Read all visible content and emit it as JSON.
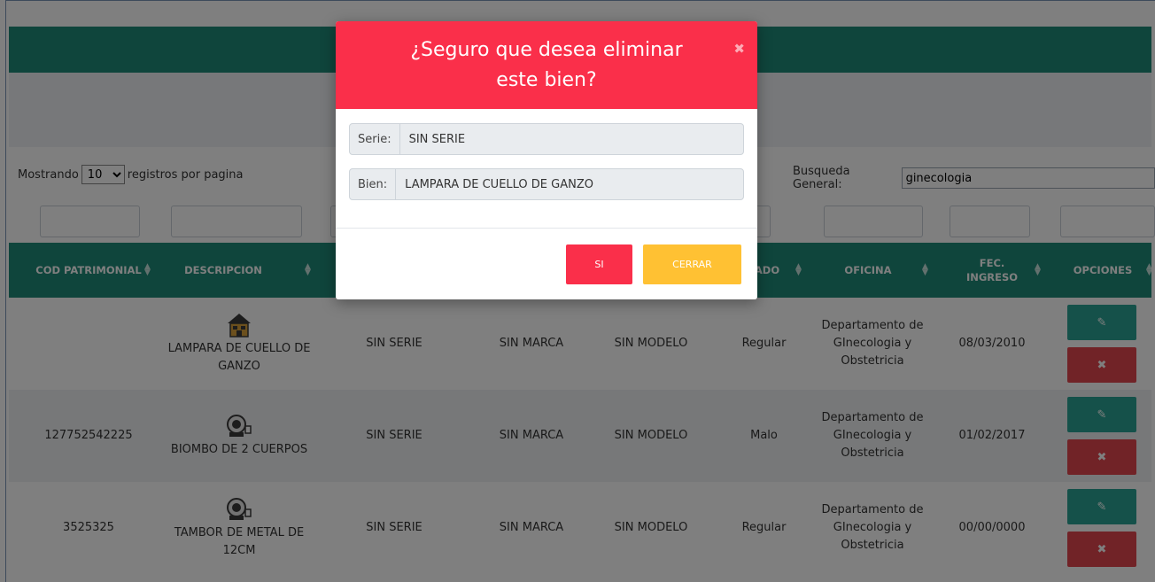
{
  "page": {
    "length_prefix": "Mostrando",
    "length_value": "10",
    "length_suffix": "registros por pagina",
    "search_label": "Busqueda General:",
    "search_value": "ginecologia"
  },
  "table": {
    "headers": [
      {
        "label": "COD PATRIMONIAL"
      },
      {
        "label": "DESCRIPCION"
      },
      {
        "label": "ADO"
      },
      {
        "label": "OFICINA"
      },
      {
        "label": "FEC. INGRESO"
      },
      {
        "label": "OPCIONES"
      }
    ],
    "rows": [
      {
        "cod": "",
        "icon": "house-icon",
        "descripcion": "LAMPARA DE CUELLO DE GANZO",
        "serie": "SIN SERIE",
        "marca": "SIN MARCA",
        "modelo": "SIN MODELO",
        "estado": "Regular",
        "oficina": "Departamento de GInecologia y Obstetricia",
        "fecha": "08/03/2010"
      },
      {
        "cod": "127752542225",
        "icon": "scanner-icon",
        "descripcion": "BIOMBO DE 2 CUERPOS",
        "serie": "SIN SERIE",
        "marca": "SIN MARCA",
        "modelo": "SIN MODELO",
        "estado": "Malo",
        "oficina": "Departamento de GInecologia y Obstetricia",
        "fecha": "01/02/2017"
      },
      {
        "cod": "3525325",
        "icon": "scanner-icon",
        "descripcion": "TAMBOR DE METAL DE 12CM",
        "serie": "SIN SERIE",
        "marca": "SIN MARCA",
        "modelo": "SIN MODELO",
        "estado": "Regular",
        "oficina": "Departamento de GInecologia y Obstetricia",
        "fecha": "00/00/0000"
      }
    ],
    "edit_glyph": "✎",
    "delete_glyph": "✖"
  },
  "modal": {
    "title": "¿Seguro que desea eliminar este bien?",
    "close_glyph": "✖",
    "serie_label": "Serie:",
    "serie_value": "SIN SERIE",
    "bien_label": "Bien:",
    "bien_value": "LAMPARA DE CUELLO DE GANZO",
    "si_label": "SI",
    "cerrar_label": "CERRAR"
  },
  "colors": {
    "teal": "#1f8a78",
    "danger": "#fa2f4a",
    "warning": "#ffc133"
  }
}
